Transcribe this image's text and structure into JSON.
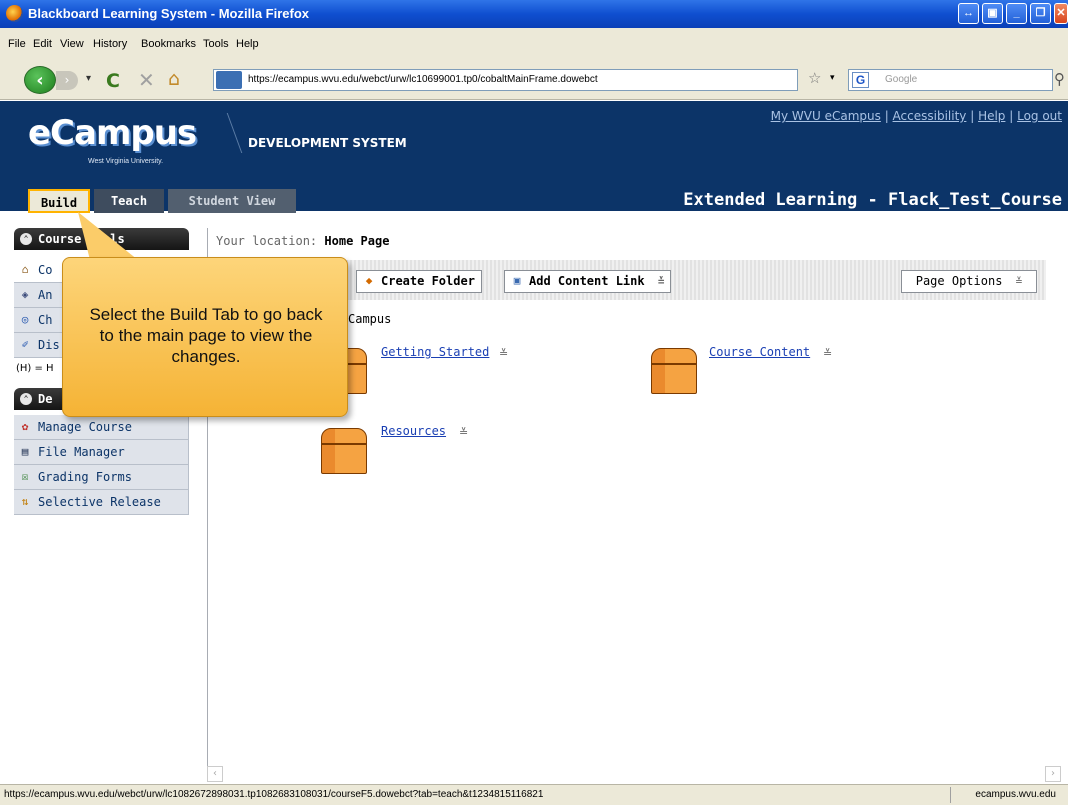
{
  "window": {
    "title": "Blackboard Learning System - Mozilla Firefox",
    "controls": [
      "↔",
      "▣",
      "_",
      "❐",
      "✕"
    ]
  },
  "menu": [
    "File",
    "Edit",
    "View",
    "History",
    "Bookmarks",
    "Tools",
    "Help"
  ],
  "navbar": {
    "back_icon": "back-arrow-icon",
    "url": "https://ecampus.wvu.edu/webct/urw/lc10699001.tp0/cobaltMainFrame.dowebct",
    "search_placeholder": "Google",
    "search_engine_letter": "G"
  },
  "header": {
    "brand": "eCampus",
    "university": "West Virginia University.",
    "system_label": "DEVELOPMENT SYSTEM",
    "links": [
      "My WVU eCampus",
      "Accessibility",
      "Help",
      "Log out"
    ],
    "course_title": "Extended Learning - Flack_Test_Course"
  },
  "tabs": {
    "build": "Build",
    "teach": "Teach",
    "student_view": "Student View"
  },
  "sidebar": {
    "course_tools_label": "Course Tools",
    "course_tools_items": [
      "Co",
      "An",
      "Ch",
      "Dis"
    ],
    "legend": "(H) = H",
    "designer_label": "De",
    "designer_items": [
      "Manage Course",
      "File Manager",
      "Grading Forms",
      "Selective Release"
    ]
  },
  "main": {
    "location_prefix": "Your location:",
    "location": "Home Page",
    "create_folder": "Create Folder",
    "add_content_link": "Add Content Link",
    "page_options": "Page Options",
    "dropdown_glyph": "≚",
    "section_label": "Campus",
    "folders": [
      "Getting Started",
      "Course Content",
      "Resources"
    ]
  },
  "callout": {
    "text": "Select the Build Tab to go back to the main page to view the changes."
  },
  "status": {
    "url": "https://ecampus.wvu.edu/webct/urw/lc1082672898031.tp1082683108031/courseF5.dowebct?tab=teach&t1234815116821",
    "host": "ecampus.wvu.edu"
  },
  "colors": {
    "header_bg": "#0c3468",
    "callout_bg": "#f5b335",
    "build_tab_highlight": "#ffb300",
    "link": "#1a3fb3"
  }
}
